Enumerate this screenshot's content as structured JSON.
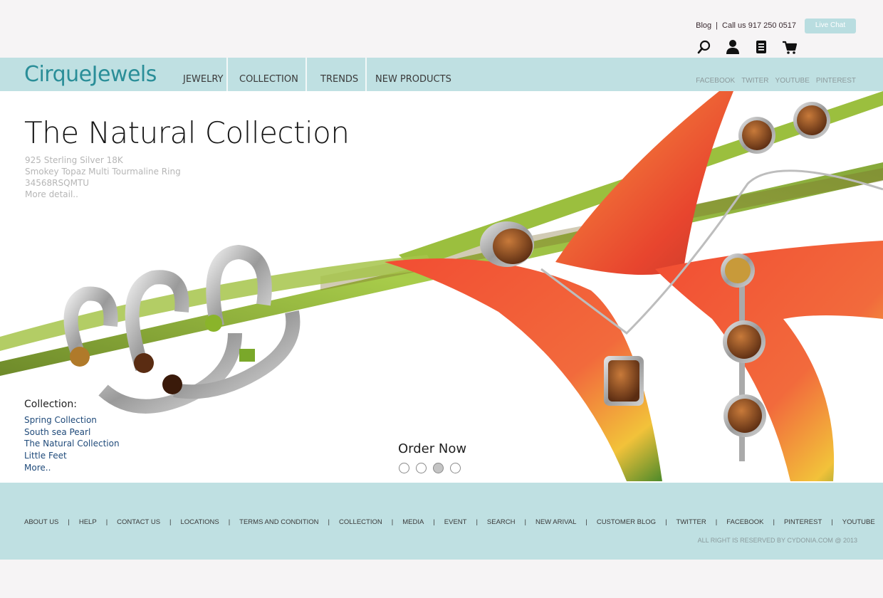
{
  "util": {
    "blog": "Blog",
    "separator": "|",
    "call": "Call us 917 250 0517",
    "live_chat": "Live Chat",
    "icons": [
      "search-icon",
      "user-icon",
      "list-icon",
      "cart-icon"
    ]
  },
  "brand": {
    "logo": "CirqueJewels"
  },
  "nav": {
    "items": [
      "JEWELRY",
      "COLLECTION",
      "TRENDS",
      "NEW PRODUCTS"
    ]
  },
  "social": [
    "FACEBOOK",
    "TWITER",
    "YOUTUBE",
    "PINTEREST"
  ],
  "hero": {
    "title": "The Natural Collection",
    "detail": [
      "925 Sterling Silver 18K",
      "Smokey Topaz Multi Tourmaline Ring",
      "34568RSQMTU",
      "More detail.."
    ],
    "collection_heading": "Collection:",
    "collections": [
      "Spring Collection",
      "South sea Pearl",
      "The Natural Collection",
      "Little Feet",
      "More.."
    ],
    "order_now": "Order Now",
    "slides": 4,
    "active_slide": 3
  },
  "footer": {
    "links": [
      "ABOUT US",
      "HELP",
      "CONTACT US",
      "LOCATIONS",
      "TERMS AND CONDITION",
      "COLLECTION",
      "MEDIA",
      "EVENT",
      "SEARCH",
      "NEW ARIVAL",
      "CUSTOMER BLOG",
      "TWITTER",
      "FACEBOOK",
      "PINTEREST",
      "YOUTUBE"
    ],
    "separator": "|",
    "copyright": "ALL RIGHT IS RESERVED BY CYDONIA.COM @ 2013"
  },
  "colors": {
    "accent": "#bfe0e2",
    "logo": "#2a8e98",
    "link": "#1f4a7a"
  }
}
